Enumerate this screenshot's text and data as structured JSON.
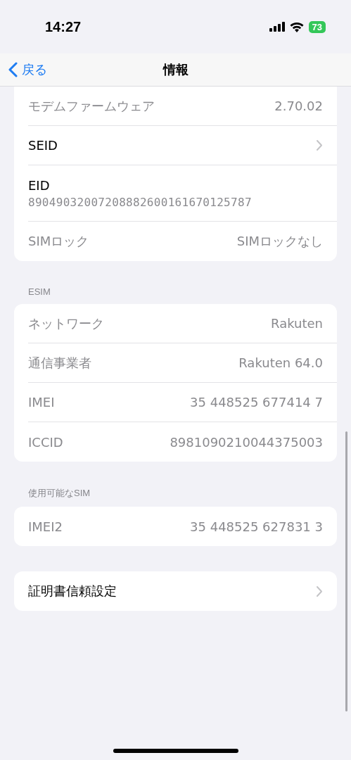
{
  "status_bar": {
    "time": "14:27",
    "battery": "73"
  },
  "nav": {
    "back": "戻る",
    "title": "情報"
  },
  "groups": [
    {
      "rows": [
        {
          "kind": "value",
          "label": "モデムファームウェア",
          "value": "2.70.02"
        },
        {
          "kind": "link",
          "label": "SEID"
        },
        {
          "kind": "stacked",
          "label": "EID",
          "value": "89049032007208882600161670125787"
        },
        {
          "kind": "value",
          "label": "SIMロック",
          "value": "SIMロックなし"
        }
      ]
    },
    {
      "header": "ESIM",
      "rows": [
        {
          "kind": "value",
          "label": "ネットワーク",
          "value": "Rakuten"
        },
        {
          "kind": "value",
          "label": "通信事業者",
          "value": "Rakuten 64.0"
        },
        {
          "kind": "value",
          "label": "IMEI",
          "value": "35 448525 677414 7"
        },
        {
          "kind": "value",
          "label": "ICCID",
          "value": "8981090210044375003"
        }
      ]
    },
    {
      "header": "使用可能なSIM",
      "rows": [
        {
          "kind": "value",
          "label": "IMEI2",
          "value": "35 448525 627831 3"
        }
      ]
    },
    {
      "rows": [
        {
          "kind": "link",
          "label": "証明書信頼設定"
        }
      ]
    }
  ]
}
